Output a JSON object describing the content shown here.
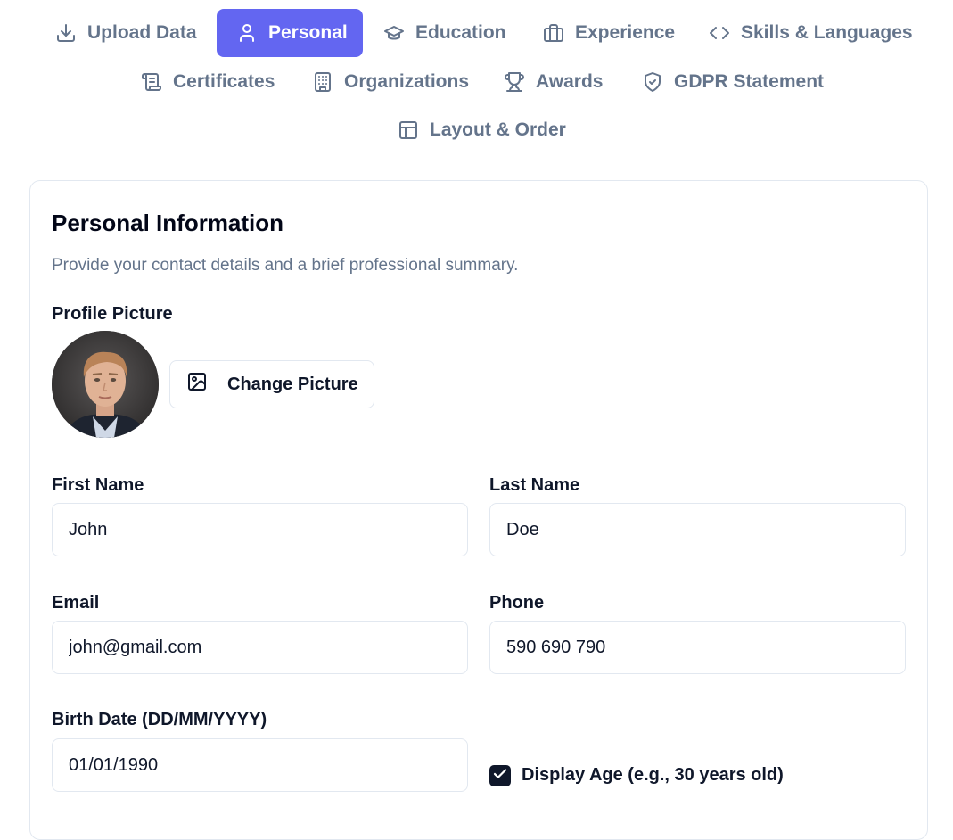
{
  "tabs": [
    {
      "label": "Upload Data",
      "icon": "download-icon",
      "active": false
    },
    {
      "label": "Personal",
      "icon": "user-icon",
      "active": true
    },
    {
      "label": "Education",
      "icon": "graduation-cap-icon",
      "active": false
    },
    {
      "label": "Experience",
      "icon": "briefcase-icon",
      "active": false
    },
    {
      "label": "Skills & Languages",
      "icon": "code-icon",
      "active": false
    },
    {
      "label": "Certificates",
      "icon": "scroll-icon",
      "active": false
    },
    {
      "label": "Organizations",
      "icon": "building-icon",
      "active": false
    },
    {
      "label": "Awards",
      "icon": "trophy-icon",
      "active": false
    },
    {
      "label": "GDPR Statement",
      "icon": "shield-icon",
      "active": false
    },
    {
      "label": "Layout & Order",
      "icon": "layout-icon",
      "active": false
    }
  ],
  "personal": {
    "title": "Personal Information",
    "subtitle": "Provide your contact details and a brief professional summary.",
    "profile_picture_label": "Profile Picture",
    "change_picture_label": "Change Picture",
    "fields": {
      "first_name": {
        "label": "First Name",
        "value": "John"
      },
      "last_name": {
        "label": "Last Name",
        "value": "Doe"
      },
      "email": {
        "label": "Email",
        "value": "john@gmail.com"
      },
      "phone": {
        "label": "Phone",
        "value": "590 690 790"
      },
      "birth_date": {
        "label": "Birth Date (DD/MM/YYYY)",
        "value": "01/01/1990"
      }
    },
    "display_age": {
      "label": "Display Age (e.g., 30 years old)",
      "checked": true
    }
  },
  "colors": {
    "accent": "#6366f1",
    "muted_text": "#64748b",
    "border": "#e2e8f0",
    "dark": "#0f172a"
  }
}
